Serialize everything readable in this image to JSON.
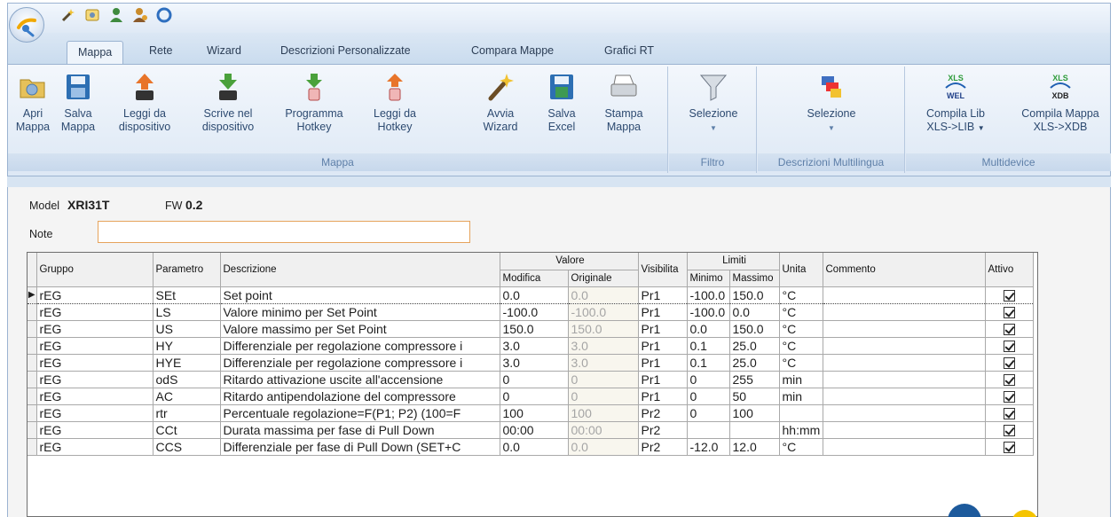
{
  "tabs": [
    {
      "label": "Mappa",
      "active": true
    },
    {
      "label": "Rete"
    },
    {
      "label": "Wizard"
    },
    {
      "label": "Descrizioni Personalizzate"
    },
    {
      "label": "Compara Mappe"
    },
    {
      "label": "Grafici RT"
    }
  ],
  "ribbon": {
    "groups": [
      {
        "label": "Mappa"
      },
      {
        "label": "Filtro"
      },
      {
        "label": "Descrizioni Multilingua"
      },
      {
        "label": "Multidevice"
      }
    ],
    "buttons": {
      "apri": [
        "Apri",
        "Mappa"
      ],
      "salva": [
        "Salva",
        "Mappa"
      ],
      "leggi_dispositivo": [
        "Leggi da",
        "dispositivo"
      ],
      "scrivi_dispositivo": [
        "Scrive nel",
        "dispositivo"
      ],
      "programma_hotkey": [
        "Programma",
        "Hotkey"
      ],
      "leggi_hotkey": [
        "Leggi da",
        "Hotkey"
      ],
      "avvia_wizard": [
        "Avvia",
        "Wizard"
      ],
      "salva_excel": [
        "Salva",
        "Excel"
      ],
      "stampa": [
        "Stampa",
        "Mappa"
      ],
      "selezione_filtro": "Selezione",
      "selezione_multilingua": "Selezione",
      "compila_lib": [
        "Compila Lib",
        "XLS->LIB"
      ],
      "compila_mappa": [
        "Compila Mappa",
        "XLS->XDB"
      ],
      "icon_text_xls1": "XLS",
      "icon_text_wel": "WEL",
      "icon_text_xls2": "XLS",
      "icon_text_xdb": "XDB"
    }
  },
  "model": {
    "label": "Model",
    "value": "XRI31T"
  },
  "fw": {
    "label": "FW",
    "value": "0.2"
  },
  "note": {
    "label": "Note",
    "value": ""
  },
  "grid": {
    "headers": {
      "gruppo": "Gruppo",
      "parametro": "Parametro",
      "descrizione": "Descrizione",
      "valore": "Valore",
      "modifica": "Modifica",
      "originale": "Originale",
      "visibilita": "Visibilita",
      "limiti": "Limiti",
      "minimo": "Minimo",
      "massimo": "Massimo",
      "unita": "Unita",
      "commento": "Commento",
      "attivo": "Attivo"
    },
    "rows": [
      [
        "rEG",
        "SEt",
        "Set point",
        "0.0",
        "0.0",
        "Pr1",
        "-100.0",
        "150.0",
        "°C"
      ],
      [
        "rEG",
        "LS",
        "Valore minimo per Set Point",
        "-100.0",
        "-100.0",
        "Pr1",
        "-100.0",
        "0.0",
        "°C"
      ],
      [
        "rEG",
        "US",
        "Valore massimo per Set Point",
        "150.0",
        "150.0",
        "Pr1",
        "0.0",
        "150.0",
        "°C"
      ],
      [
        "rEG",
        "HY",
        "Differenziale per regolazione compressore i",
        "3.0",
        "3.0",
        "Pr1",
        "0.1",
        "25.0",
        "°C"
      ],
      [
        "rEG",
        "HYE",
        "Differenziale per regolazione compressore i",
        "3.0",
        "3.0",
        "Pr1",
        "0.1",
        "25.0",
        "°C"
      ],
      [
        "rEG",
        "odS",
        "Ritardo attivazione uscite all'accensione",
        "0",
        "0",
        "Pr1",
        "0",
        "255",
        "min"
      ],
      [
        "rEG",
        "AC",
        "Ritardo antipendolazione del compressore",
        "0",
        "0",
        "Pr1",
        "0",
        "50",
        "min"
      ],
      [
        "rEG",
        "rtr",
        "Percentuale regolazione=F(P1; P2) (100=F",
        "100",
        "100",
        "Pr2",
        "0",
        "100",
        ""
      ],
      [
        "rEG",
        "CCt",
        "Durata massima per fase di Pull Down",
        "00:00",
        "00:00",
        "Pr2",
        "",
        "",
        "hh:mm"
      ],
      [
        "rEG",
        "CCS",
        "Differenziale per fase di Pull Down (SET+C",
        "0.0",
        "0.0",
        "Pr2",
        "-12.0",
        "12.0",
        "°C"
      ]
    ]
  }
}
